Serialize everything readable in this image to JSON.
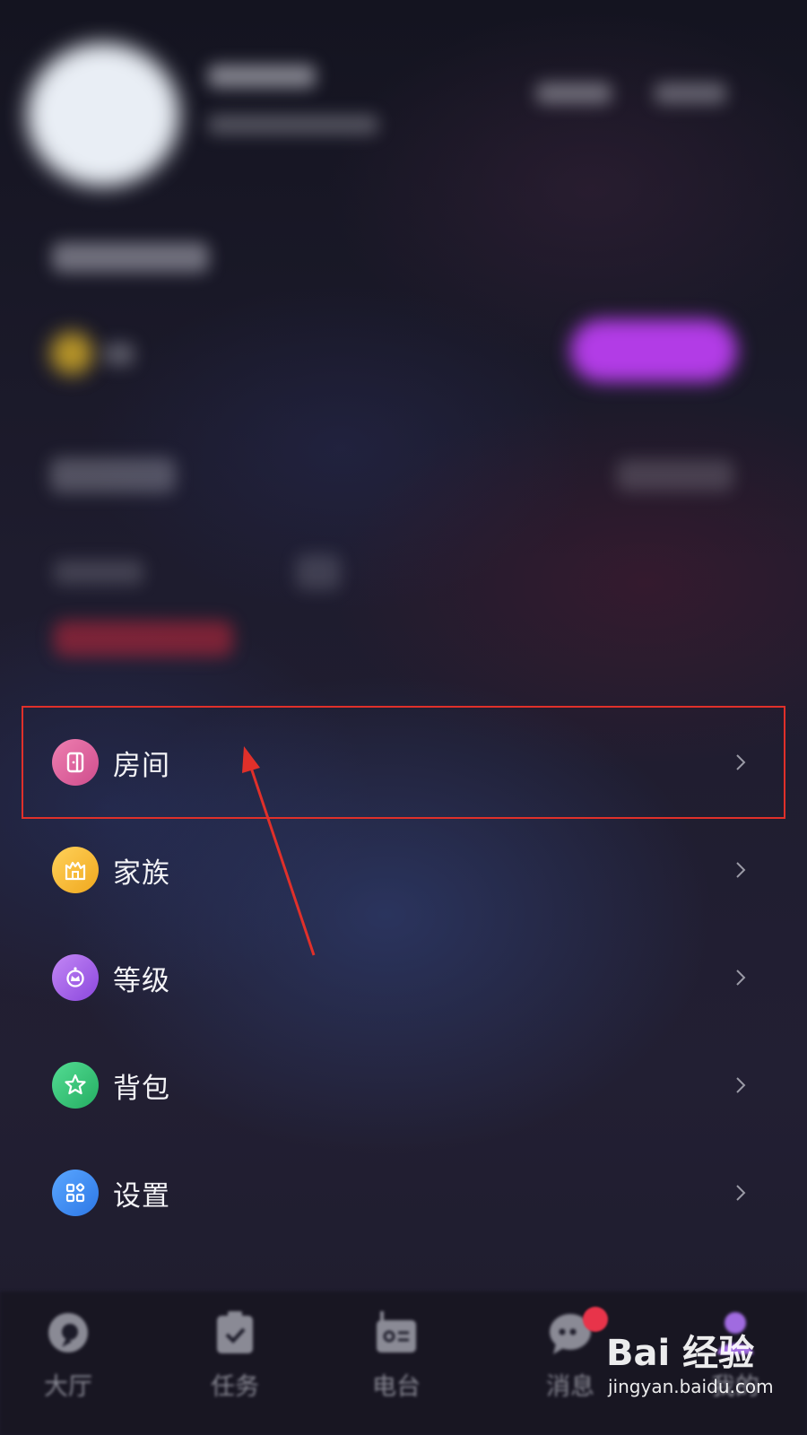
{
  "menu": {
    "items": [
      {
        "label": "房间",
        "icon": "room-door-icon",
        "color": "#d9609c"
      },
      {
        "label": "家族",
        "icon": "family-castle-icon",
        "color": "#f2b62c"
      },
      {
        "label": "等级",
        "icon": "level-crown-icon",
        "color": "#a45ce8"
      },
      {
        "label": "背包",
        "icon": "backpack-star-icon",
        "color": "#34c779"
      },
      {
        "label": "设置",
        "icon": "settings-grid-icon",
        "color": "#3a8cf2"
      }
    ]
  },
  "annotation": {
    "box_color": "#e0302a",
    "arrow_color": "#e0302a"
  },
  "bottom_nav": {
    "tabs": [
      {
        "label": "大厅",
        "icon": "lobby-icon"
      },
      {
        "label": "任务",
        "icon": "task-clipboard-icon"
      },
      {
        "label": "电台",
        "icon": "radio-icon"
      },
      {
        "label": "消息",
        "icon": "message-bubble-icon"
      },
      {
        "label": "我的",
        "icon": "profile-icon"
      }
    ]
  },
  "watermark": {
    "main": "Bai 经验",
    "sub": "jingyan.baidu.com"
  }
}
